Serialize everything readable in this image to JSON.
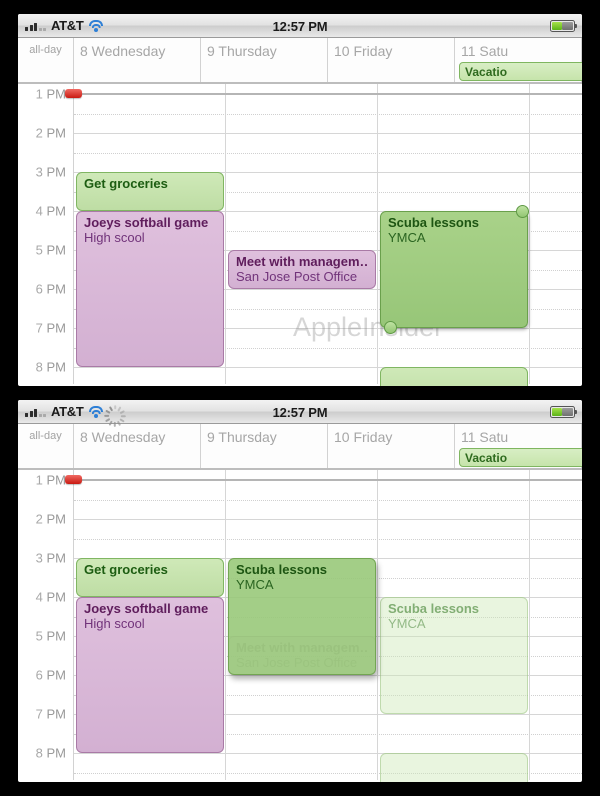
{
  "panels": [
    {
      "id": "panel-before-drag",
      "status_bar": {
        "carrier": "AT&T",
        "time": "12:57 PM",
        "signal_icon": "signal-bars-icon",
        "wifi_icon": "wifi-icon",
        "battery_icon": "battery-icon",
        "has_activity_spinner": false
      },
      "calendar": {
        "allday_label": "all-day",
        "days": [
          {
            "label": "8 Wednesday"
          },
          {
            "label": "9 Thursday"
          },
          {
            "label": "10 Friday"
          },
          {
            "label": "11 Satu"
          }
        ],
        "allday_events": [
          {
            "title": "Vacatio",
            "day": 3,
            "color": "#2e6a1e"
          }
        ],
        "time_labels": [
          "1 PM",
          "2 PM",
          "3 PM",
          "4 PM",
          "5 PM",
          "6 PM",
          "7 PM",
          "8 PM"
        ],
        "now_marker": {
          "time_label": "1 PM",
          "color": "#c91a12"
        },
        "events": [
          {
            "name": "event-get-groceries",
            "title": "Get groceries",
            "location": "",
            "day": 0,
            "start": "3:00 PM",
            "end": "4:00 PM",
            "style": "green",
            "selected": false
          },
          {
            "name": "event-joeys-softball-game",
            "title": "Joeys softball game",
            "location": "High scool",
            "day": 0,
            "start": "4:00 PM",
            "end": "8:00 PM",
            "style": "purple",
            "selected": false
          },
          {
            "name": "event-meet-with-management",
            "title": "Meet with managem…",
            "location": "San Jose Post Office",
            "day": 1,
            "start": "5:00 PM",
            "end": "6:00 PM",
            "style": "purple",
            "selected": false
          },
          {
            "name": "event-scuba-lessons",
            "title": "Scuba lessons",
            "location": "YMCA",
            "day": 2,
            "start": "4:00 PM",
            "end": "7:00 PM",
            "style": "green",
            "selected": true
          },
          {
            "name": "event-partial-bottom",
            "title": "",
            "location": "",
            "day": 2,
            "start": "8:00 PM",
            "end": "9:00 PM",
            "style": "green",
            "selected": false
          }
        ],
        "watermark": "AppleInsider"
      }
    },
    {
      "id": "panel-during-drag",
      "status_bar": {
        "carrier": "AT&T",
        "time": "12:57 PM",
        "signal_icon": "signal-bars-icon",
        "wifi_icon": "wifi-icon",
        "battery_icon": "battery-icon",
        "activity_icon": "activity-spinner-icon",
        "has_activity_spinner": true
      },
      "calendar": {
        "allday_label": "all-day",
        "days": [
          {
            "label": "8 Wednesday"
          },
          {
            "label": "9 Thursday"
          },
          {
            "label": "10 Friday"
          },
          {
            "label": "11 Satu"
          }
        ],
        "allday_events": [
          {
            "title": "Vacatio",
            "day": 3,
            "color": "#2e6a1e"
          }
        ],
        "time_labels": [
          "1 PM",
          "2 PM",
          "3 PM",
          "4 PM",
          "5 PM",
          "6 PM",
          "7 PM",
          "8 PM"
        ],
        "now_marker": {
          "time_label": "1 PM",
          "color": "#c91a12"
        },
        "events": [
          {
            "name": "event-get-groceries",
            "title": "Get groceries",
            "location": "",
            "day": 0,
            "start": "3:00 PM",
            "end": "4:00 PM",
            "style": "green",
            "selected": false
          },
          {
            "name": "event-joeys-softball-game",
            "title": "Joeys softball game",
            "location": "High scool",
            "day": 0,
            "start": "4:00 PM",
            "end": "8:00 PM",
            "style": "purple",
            "selected": false
          },
          {
            "name": "event-meet-with-management-dimmed",
            "title": "Meet with managem…",
            "location": "San Jose Post Office",
            "day": 1,
            "start": "5:00 PM",
            "end": "6:00 PM",
            "style": "purple-dimmed",
            "selected": false
          },
          {
            "name": "event-scuba-lessons-dragging",
            "title": "Scuba lessons",
            "location": "YMCA",
            "day": 1,
            "start": "3:00 PM",
            "end": "6:00 PM",
            "style": "dragging",
            "selected": false
          },
          {
            "name": "event-scuba-lessons-ghost",
            "title": "Scuba lessons",
            "location": "YMCA",
            "day": 2,
            "start": "4:00 PM",
            "end": "7:00 PM",
            "style": "ghost",
            "selected": false
          },
          {
            "name": "event-partial-bottom",
            "title": "",
            "location": "",
            "day": 2,
            "start": "8:00 PM",
            "end": "9:00 PM",
            "style": "ghost",
            "selected": false
          }
        ],
        "watermark": ""
      }
    }
  ]
}
